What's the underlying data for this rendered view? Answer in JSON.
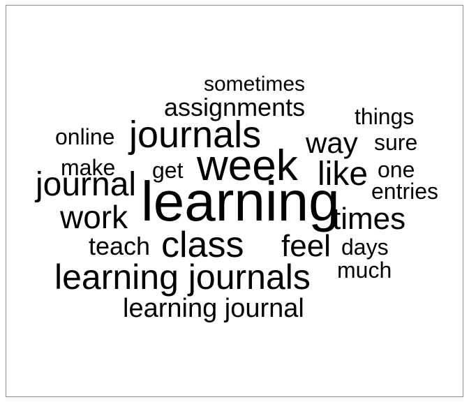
{
  "text_color": "#000000",
  "frame_border_color": "#8c8c8c",
  "words": [
    {
      "text": "learning",
      "weight": 1.0
    },
    {
      "text": "week",
      "weight": 0.78
    },
    {
      "text": "learning journals",
      "weight": 0.68
    },
    {
      "text": "journals",
      "weight": 0.64
    },
    {
      "text": "class",
      "weight": 0.62
    },
    {
      "text": "journal",
      "weight": 0.56
    },
    {
      "text": "like",
      "weight": 0.56
    },
    {
      "text": "work",
      "weight": 0.56
    },
    {
      "text": "feel",
      "weight": 0.52
    },
    {
      "text": "times",
      "weight": 0.52
    },
    {
      "text": "way",
      "weight": 0.5
    },
    {
      "text": "learning journal",
      "weight": 0.46
    },
    {
      "text": "assignments",
      "weight": 0.43
    },
    {
      "text": "teach",
      "weight": 0.42
    },
    {
      "text": "sometimes",
      "weight": 0.39
    },
    {
      "text": "things",
      "weight": 0.39
    },
    {
      "text": "online",
      "weight": 0.38
    },
    {
      "text": "sure",
      "weight": 0.38
    },
    {
      "text": "get",
      "weight": 0.38
    },
    {
      "text": "make",
      "weight": 0.38
    },
    {
      "text": "one",
      "weight": 0.38
    },
    {
      "text": "entries",
      "weight": 0.37
    },
    {
      "text": "days",
      "weight": 0.37
    },
    {
      "text": "much",
      "weight": 0.37
    }
  ]
}
